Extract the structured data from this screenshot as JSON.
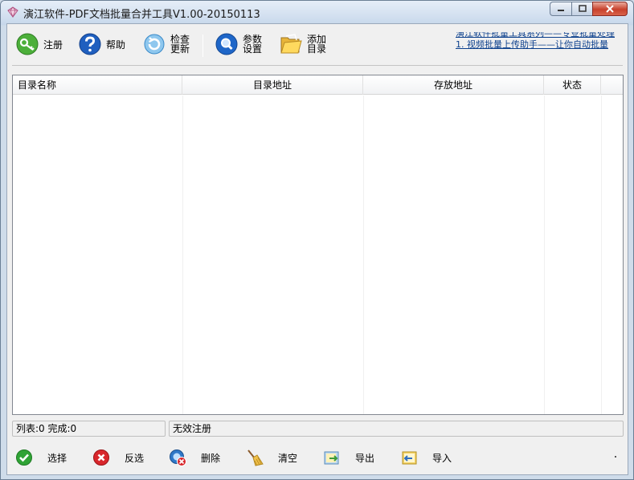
{
  "window": {
    "title": "演江软件-PDF文档批量合并工具V1.00-20150113"
  },
  "toolbar": {
    "register_label": "注册",
    "help_label": "帮助",
    "update_line1": "检查",
    "update_line2": "更新",
    "settings_line1": "参数",
    "settings_line2": "设置",
    "add_dir_line1": "添加",
    "add_dir_line2": "目录",
    "ad_link_1": "演江软件批量工具系列——专业批量处理",
    "ad_link_2": "1. 视频批量上传助手——让你自动批量"
  },
  "list": {
    "columns": [
      "目录名称",
      "目录地址",
      "存放地址",
      "状态",
      ""
    ],
    "rows": []
  },
  "status": {
    "counts": "列表:0 完成:0",
    "registration": "无效注册"
  },
  "bottom": {
    "select_label": "选择",
    "invert_label": "反选",
    "delete_label": "删除",
    "clear_label": "清空",
    "export_label": "导出",
    "import_label": "导入"
  },
  "colors": {
    "accent_blue": "#1f5fbf",
    "link_blue": "#0b3f8c",
    "close_red": "#c8412c",
    "check_green": "#2fa335",
    "cross_red": "#d8262b"
  },
  "icons": {
    "register": "key-icon",
    "help": "question-icon",
    "update": "refresh-icon",
    "settings": "magnifier-settings-icon",
    "add_dir": "folder-open-icon",
    "select": "check-circle-icon",
    "invert": "x-circle-icon",
    "delete": "delete-icon",
    "clear": "broom-icon",
    "export": "export-icon",
    "import": "import-icon"
  }
}
